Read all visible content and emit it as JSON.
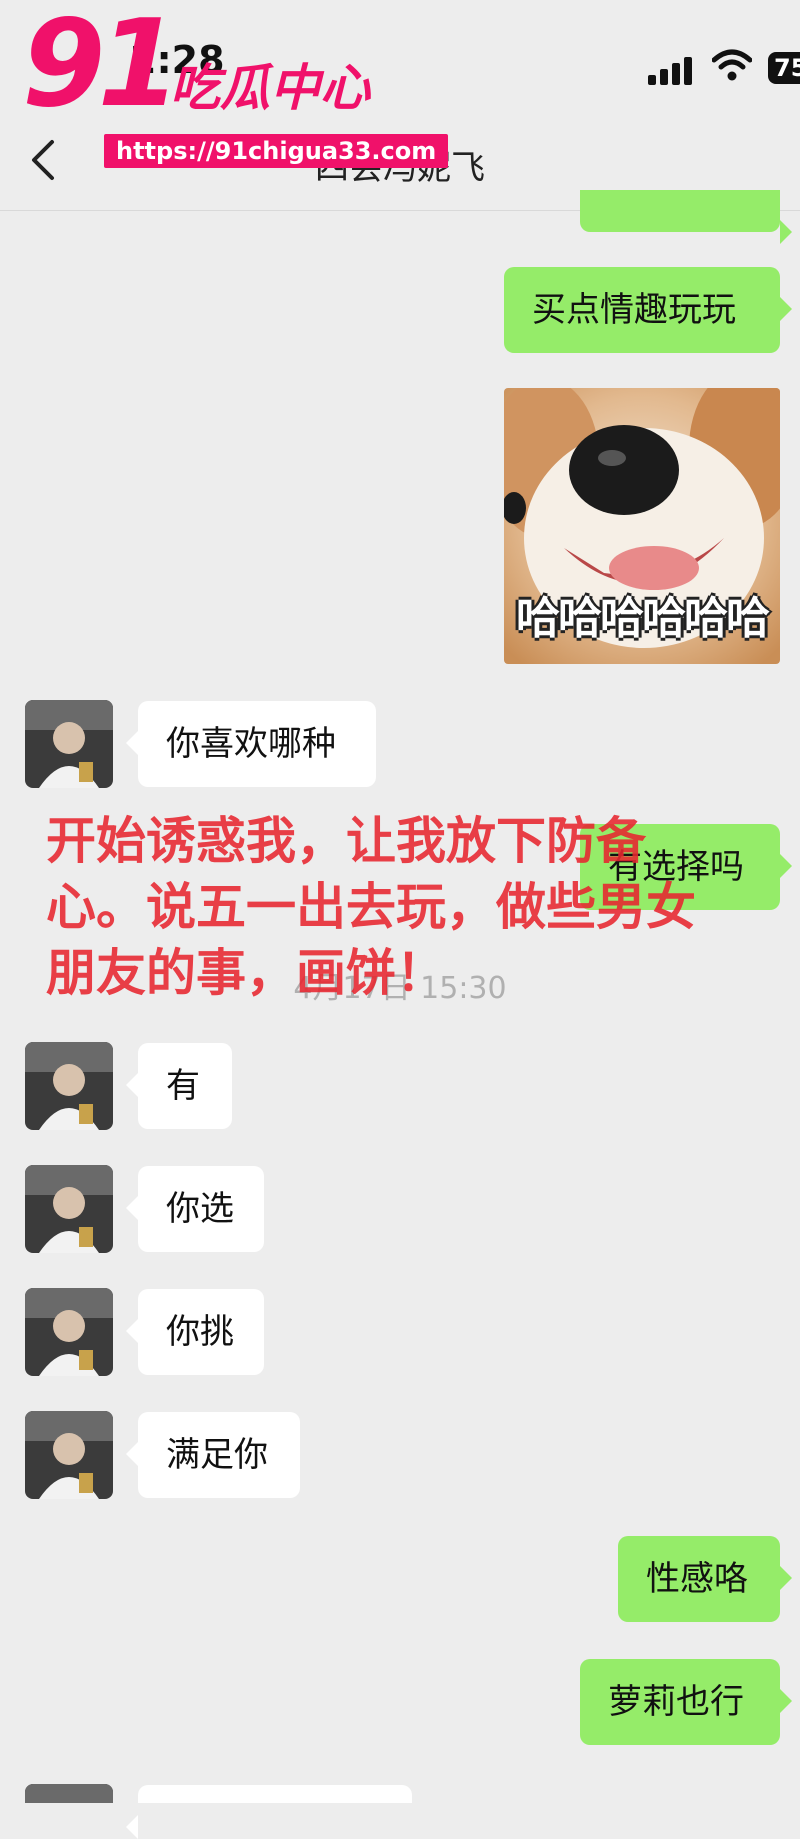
{
  "status_bar": {
    "time": "2:28",
    "battery": "75"
  },
  "chat": {
    "title": "四会冯妮飞",
    "timestamp": "4月17日 15:30"
  },
  "messages": [
    {
      "side": "out",
      "text": "买点情趣玩玩"
    },
    {
      "side": "out",
      "type": "sticker",
      "caption": "哈哈哈哈哈哈"
    },
    {
      "side": "in",
      "text": "你喜欢哪种"
    },
    {
      "side": "out",
      "text": "有选择吗"
    },
    {
      "side": "in",
      "text": "有"
    },
    {
      "side": "in",
      "text": "你选"
    },
    {
      "side": "in",
      "text": "你挑"
    },
    {
      "side": "in",
      "text": "满足你"
    },
    {
      "side": "out",
      "text": "性感咯"
    },
    {
      "side": "out",
      "text": "萝莉也行"
    }
  ],
  "overlay_annotation": "开始诱惑我，让我放下防备心。说五一出去玩，做些男女朋友的事，画饼！",
  "watermark": {
    "number": "91",
    "name": "吃瓜中心",
    "url": "https://91chigua33.com"
  },
  "colors": {
    "background": "#ededed",
    "outgoing_bubble": "#95ec69",
    "incoming_bubble": "#ffffff",
    "annotation": "#e8262f",
    "watermark": "#f0116a"
  }
}
